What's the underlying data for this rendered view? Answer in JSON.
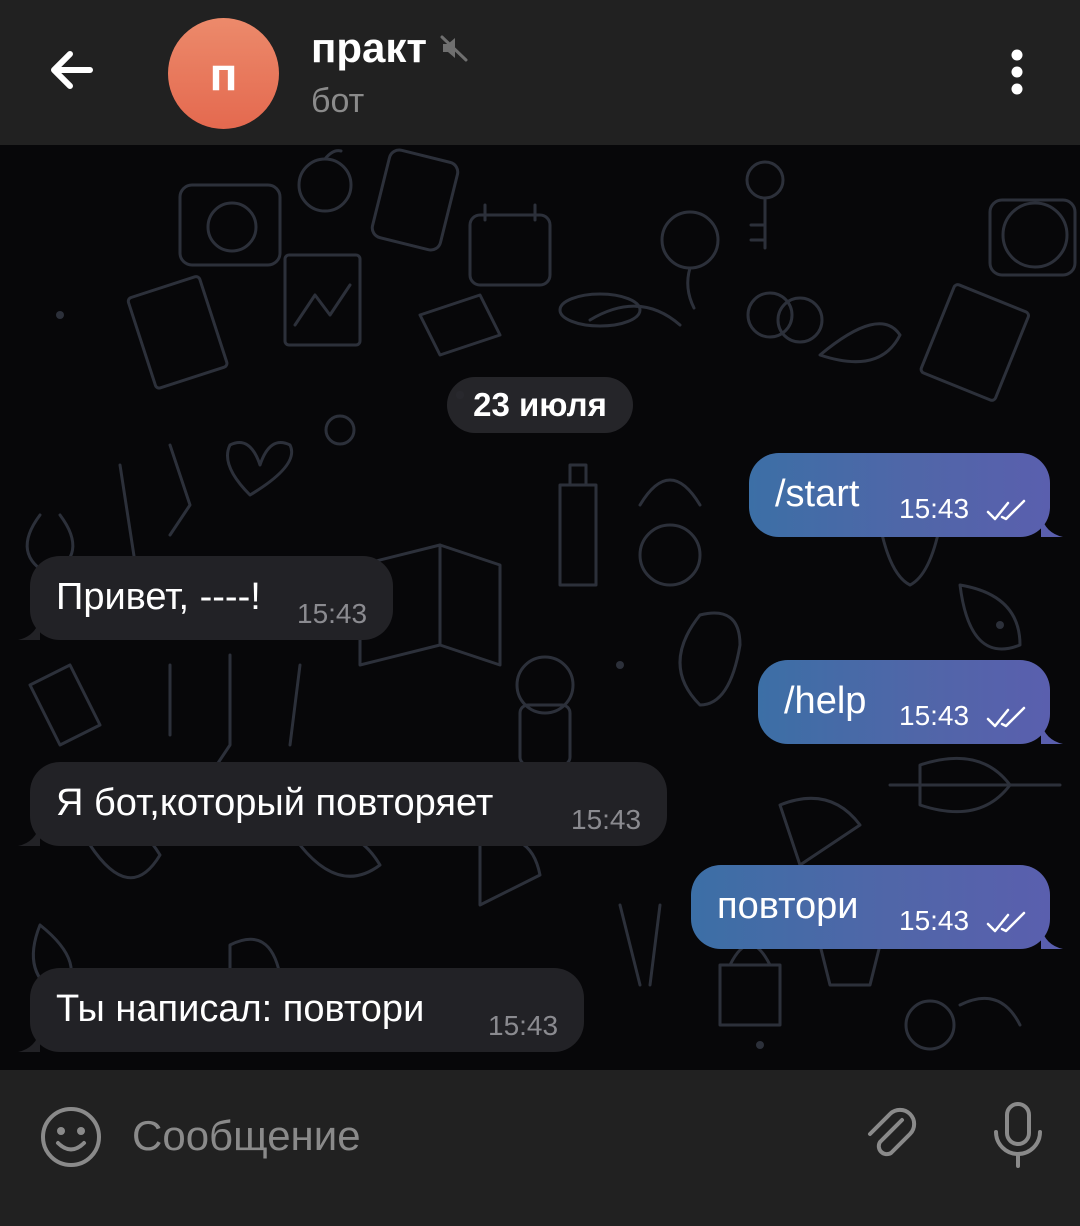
{
  "header": {
    "avatar_letter": "п",
    "title": "практ",
    "subtitle": "бот",
    "back_icon": "arrow-left-icon",
    "muted_icon": "muted-speaker-icon",
    "menu_icon": "more-vert-icon",
    "avatar_color": "#e8775c"
  },
  "chat": {
    "date_label": "23 июля",
    "messages": [
      {
        "direction": "outgoing",
        "text": "/start",
        "time": "15:43",
        "status": "read"
      },
      {
        "direction": "incoming",
        "text": "Привет, ----!",
        "time": "15:43"
      },
      {
        "direction": "outgoing",
        "text": "/help",
        "time": "15:43",
        "status": "read"
      },
      {
        "direction": "incoming",
        "text": "Я бот,который повторяет",
        "time": "15:43"
      },
      {
        "direction": "outgoing",
        "text": "повтори",
        "time": "15:43",
        "status": "read"
      },
      {
        "direction": "incoming",
        "text": "Ты написал: повтори",
        "time": "15:43"
      }
    ]
  },
  "input": {
    "placeholder": "Сообщение",
    "value": "",
    "emoji_icon": "emoji-smile-icon",
    "attach_icon": "paperclip-icon",
    "mic_icon": "microphone-icon"
  },
  "colors": {
    "header_bg": "#212121",
    "outgoing_bubble": "#4a6aa8",
    "incoming_bubble": "#222226",
    "chat_bg": "#070709"
  }
}
